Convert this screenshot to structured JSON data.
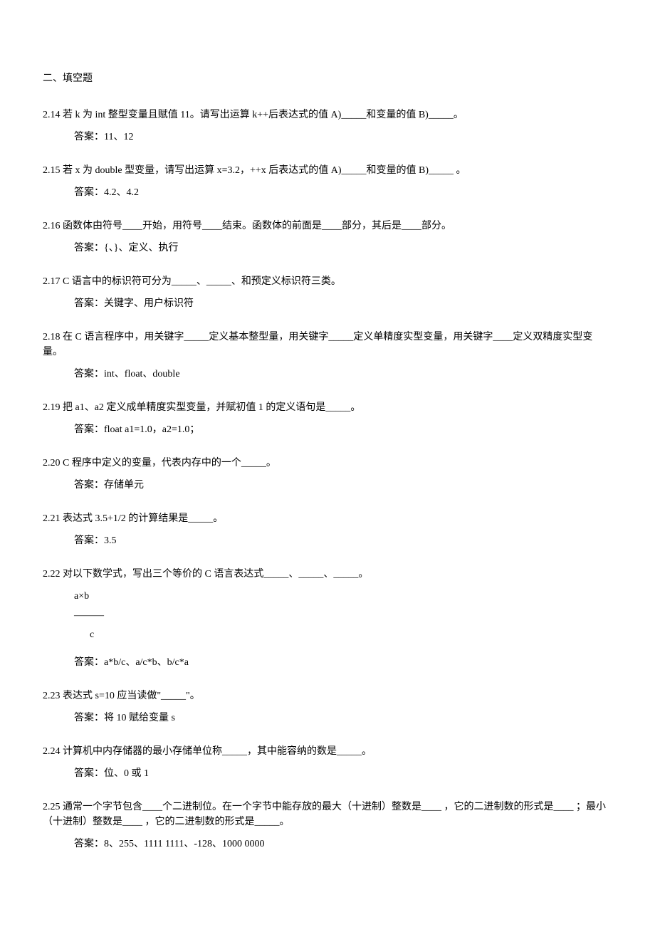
{
  "section_title": "二、填空题",
  "q214": {
    "text": "2.14 若 k 为 int 整型变量且赋值 11。请写出运算 k++后表达式的值 A)_____和变量的值 B)_____。",
    "answer": "答案：11、12"
  },
  "q215": {
    "text": "2.15 若 x 为 double 型变量，请写出运算 x=3.2，++x 后表达式的值 A)_____和变量的值 B)_____ 。",
    "answer": "答案：4.2、4.2"
  },
  "q216": {
    "text": "2.16 函数体由符号____开始，用符号____结束。函数体的前面是____部分，其后是____部分。",
    "answer": "答案：{、}、定义、执行"
  },
  "q217": {
    "text": "2.17 C 语言中的标识符可分为_____、_____、和预定义标识符三类。",
    "answer": "答案：关键字、用户标识符"
  },
  "q218": {
    "text": "2.18 在 C 语言程序中，用关键字_____定义基本整型量，用关键字_____定义单精度实型变量，用关键字____定义双精度实型变量。",
    "answer": "答案：int、float、double"
  },
  "q219": {
    "text": "2.19 把 a1、a2 定义成单精度实型变量，并赋初值 1 的定义语句是_____。",
    "answer": "答案：float   a1=1.0，a2=1.0；"
  },
  "q220": {
    "text": "2.20 C 程序中定义的变量，代表内存中的一个_____。",
    "answer": "答案：存储单元"
  },
  "q221": {
    "text": "2.21 表达式 3.5+1/2 的计算结果是_____。",
    "answer": "答案：3.5"
  },
  "q222": {
    "text": "2.22 对以下数学式，写出三个等价的 C 语言表达式_____、_____、_____。",
    "frac_top": "a×b",
    "frac_line": "———",
    "frac_bot": "c",
    "answer": "答案：a*b/c、a/c*b、b/c*a"
  },
  "q223": {
    "text": "2.23 表达式 s=10 应当读做\"_____\"。",
    "answer": "答案：将 10 赋给变量 s"
  },
  "q224": {
    "text": "2.24 计算机中内存储器的最小存储单位称_____，其中能容纳的数是_____。",
    "answer": "答案：位、0 或 1"
  },
  "q225": {
    "text": "2.25 通常一个字节包含____个二进制位。在一个字节中能存放的最大（十进制）整数是____ ，它的二进制数的形式是____ ；最小（十进制）整数是____ ，它的二进制数的形式是_____。",
    "answer": "答案：8、255、1111 1111、-128、1000 0000"
  }
}
